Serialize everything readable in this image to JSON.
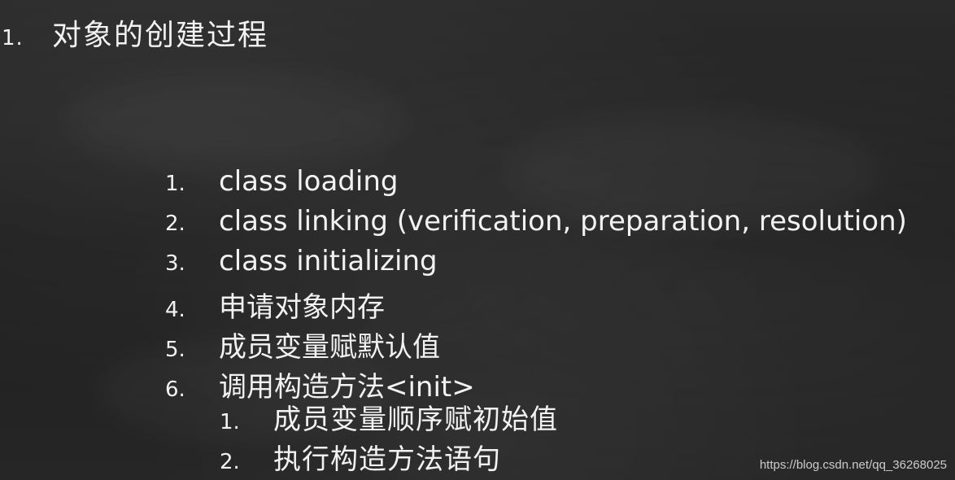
{
  "title": {
    "number": "1.",
    "text": "对象的创建过程"
  },
  "steps": [
    {
      "number": "1.",
      "text": "class loading"
    },
    {
      "number": "2.",
      "text": "class linking (verification, preparation, resolution)"
    },
    {
      "number": "3.",
      "text": "class initializing"
    },
    {
      "number": "4.",
      "text": "申请对象内存"
    },
    {
      "number": "5.",
      "text": "成员变量赋默认值"
    },
    {
      "number": "6.",
      "text": "调用构造方法<init>"
    }
  ],
  "substeps": [
    {
      "number": "1.",
      "text": "成员变量顺序赋初始值"
    },
    {
      "number": "2.",
      "text": "执行构造方法语句"
    }
  ],
  "watermark": "https://blog.csdn.net/qq_36268025"
}
